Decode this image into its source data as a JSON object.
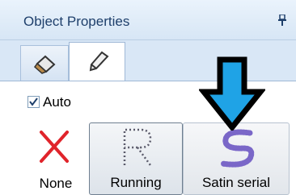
{
  "panel": {
    "title": "Object Properties"
  },
  "tabs": [
    {
      "icon": "fill-bucket-icon",
      "active": false
    },
    {
      "icon": "pen-icon",
      "active": true
    }
  ],
  "auto_checkbox": {
    "label": "Auto",
    "checked": true
  },
  "stitch_styles": [
    {
      "label": "None",
      "icon": "red-x-icon",
      "selected": false
    },
    {
      "label": "Running",
      "icon": "running-stitch-r-icon",
      "selected": true
    },
    {
      "label": "Satin serial",
      "icon": "satin-serial-icon",
      "selected": false
    }
  ],
  "colors": {
    "arrow": "#1fa3e6",
    "none_x": "#e0242b",
    "satin_stitch": "#7a67c8"
  }
}
